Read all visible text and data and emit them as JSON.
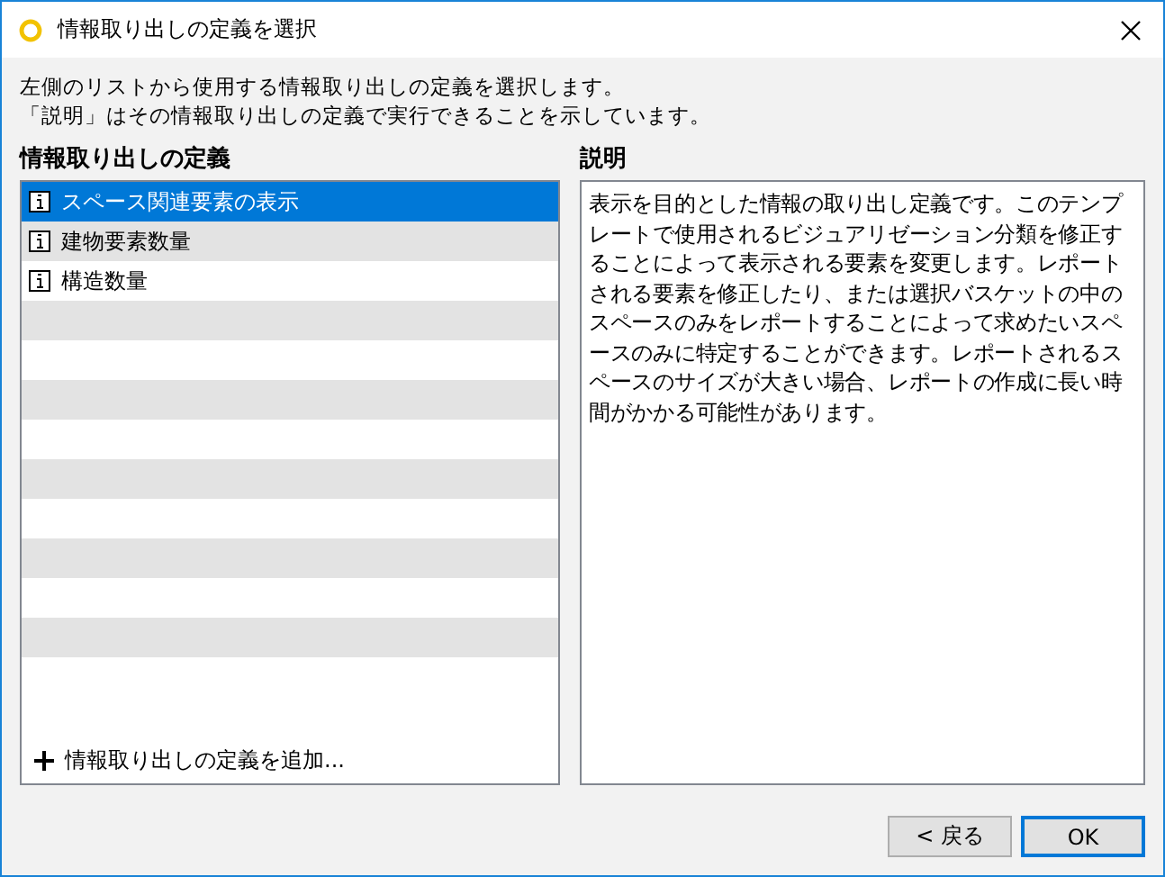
{
  "window": {
    "title": "情報取り出しの定義を選択"
  },
  "instructions": [
    "左側のリストから使用する情報取り出しの定義を選択します。",
    "「説明」はその情報取り出しの定義で実行できることを示しています。"
  ],
  "definitions": {
    "heading": "情報取り出しの定義",
    "items": [
      {
        "label": "スペース関連要素の表示",
        "selected": true
      },
      {
        "label": "建物要素数量",
        "selected": false
      },
      {
        "label": "構造数量",
        "selected": false
      }
    ],
    "add_link": "情報取り出しの定義を追加..."
  },
  "description": {
    "heading": "説明",
    "text": "表示を目的とした情報の取り出し定義です。このテンプレートで使用されるビジュアリゼーション分類を修正することによって表示される要素を変更します。レポートされる要素を修正したり、または選択バスケットの中のスペースのみをレポートすることによって求めたいスペースのみに特定することができます。レポートされるスペースのサイズが大きい場合、レポートの作成に長い時間がかかる可能性があります。"
  },
  "buttons": [
    {
      "label": "< 戻る",
      "kind": "normal"
    },
    {
      "label": "OK",
      "kind": "default"
    }
  ]
}
